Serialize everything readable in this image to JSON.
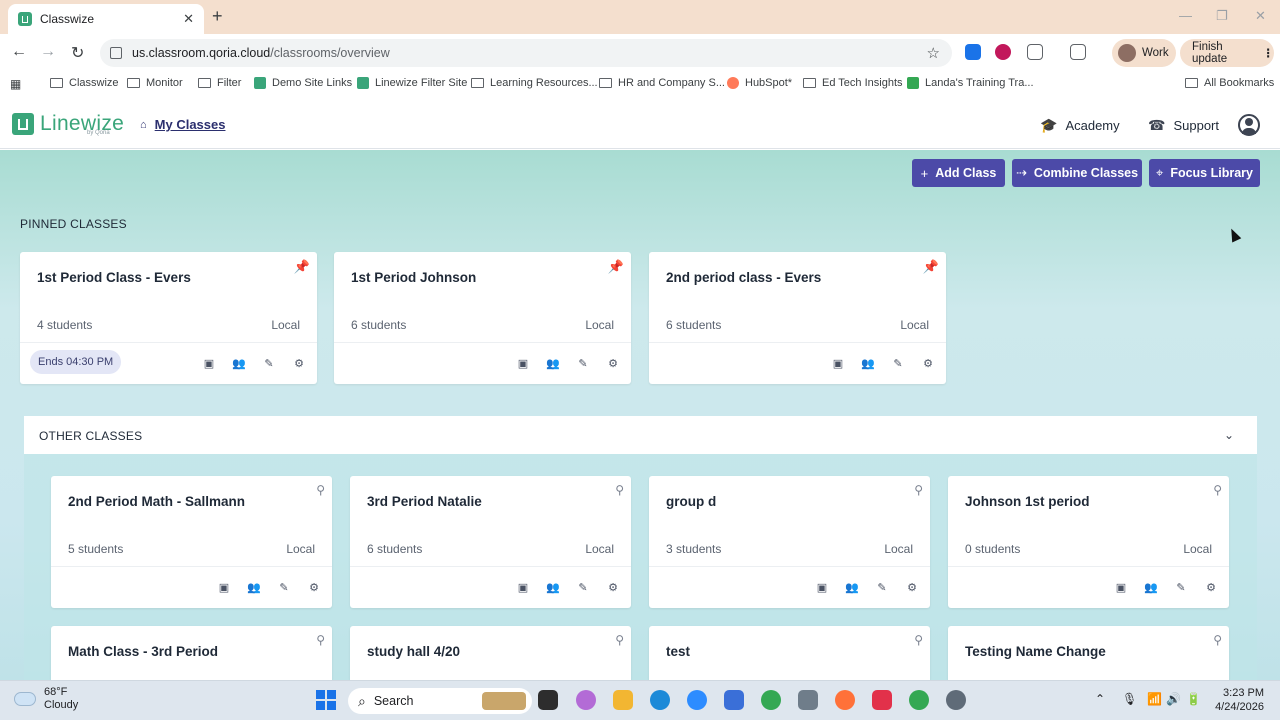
{
  "browser": {
    "tab_title": "Classwize",
    "url_host": "us.classroom.qoria.cloud",
    "url_path": "/classrooms/overview",
    "profile_label": "Work",
    "update_label": "Finish update",
    "bookmarks": [
      "Classwize",
      "Monitor",
      "Filter",
      "Demo Site Links",
      "Linewize Filter Site",
      "Learning Resources...",
      "HR and Company S...",
      "HubSpot*",
      "Ed Tech Insights",
      "Landa's Training Tra...",
      "All Bookmarks"
    ]
  },
  "app": {
    "brand": "Linewize",
    "brand_sub": "by Qoria",
    "nav_current": "My Classes",
    "academy_label": "Academy",
    "support_label": "Support"
  },
  "actions": {
    "add_class": "Add Class",
    "combine_classes": "Combine Classes",
    "focus_library": "Focus Library"
  },
  "pinned": {
    "title": "PINNED CLASSES",
    "classes": [
      {
        "name": "1st Period Class - Evers",
        "students": "4 students",
        "type": "Local",
        "ends": "Ends 04:30 PM"
      },
      {
        "name": "1st Period Johnson",
        "students": "6 students",
        "type": "Local"
      },
      {
        "name": "2nd period class - Evers",
        "students": "6 students",
        "type": "Local"
      }
    ]
  },
  "other": {
    "title": "OTHER CLASSES",
    "classes": [
      {
        "name": "2nd Period Math - Sallmann",
        "students": "5 students",
        "type": "Local"
      },
      {
        "name": "3rd Period Natalie",
        "students": "6 students",
        "type": "Local"
      },
      {
        "name": "group d",
        "students": "3 students",
        "type": "Local"
      },
      {
        "name": "Johnson 1st period",
        "students": "0 students",
        "type": "Local"
      },
      {
        "name": "Math Class - 3rd Period"
      },
      {
        "name": "study hall 4/20"
      },
      {
        "name": "test"
      },
      {
        "name": "Testing Name Change"
      }
    ]
  },
  "taskbar": {
    "temp": "68°F",
    "condition": "Cloudy",
    "search_label": "Search",
    "time": "3:23 PM",
    "date": "4/24/2026"
  },
  "colors": {
    "brand_green": "#3aa57a",
    "action_purple": "#4c4aa8",
    "pin_orange": "#e08a2b"
  }
}
